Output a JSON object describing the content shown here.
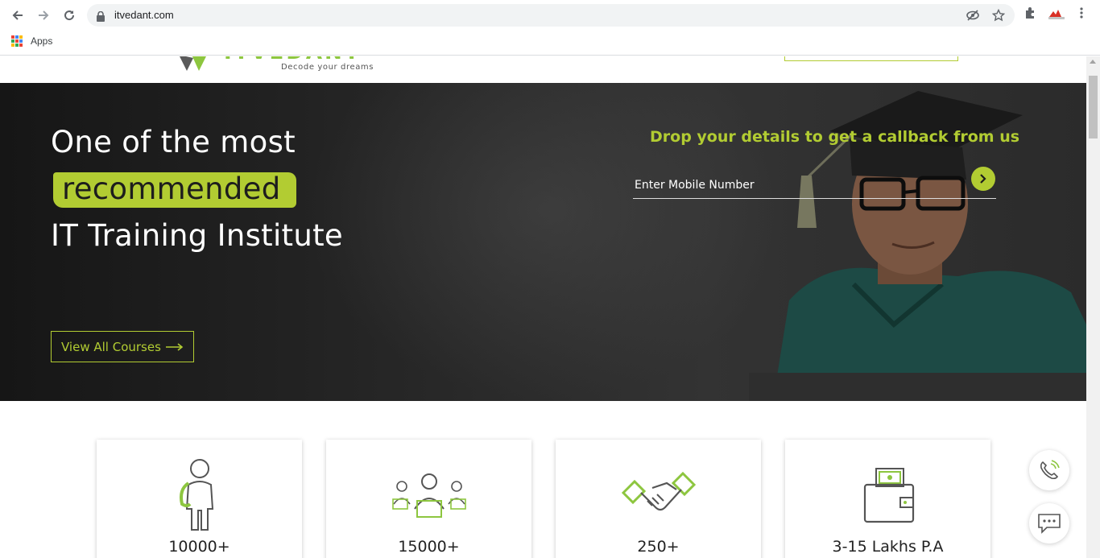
{
  "browser": {
    "url": "itvedant.com",
    "bookmarks_apps_label": "Apps"
  },
  "site": {
    "logo_word": "ITVEDANT",
    "logo_tagline": "Decode your dreams"
  },
  "hero": {
    "line1": "One of the most",
    "line2": "recommended",
    "line3": "IT Training Institute",
    "view_courses_label": "View All Courses",
    "callback_title": "Drop your details to get a callback from us",
    "mobile_placeholder": "Enter Mobile Number"
  },
  "stats": [
    {
      "value": "10000+",
      "icon": "student-icon"
    },
    {
      "value": "15000+",
      "icon": "group-laptop-icon"
    },
    {
      "value": "250+",
      "icon": "handshake-icon"
    },
    {
      "value": "3-15 Lakhs P.A",
      "icon": "wallet-icon"
    }
  ],
  "colors": {
    "accent": "#b2cc32",
    "hero_bg": "#222222"
  }
}
